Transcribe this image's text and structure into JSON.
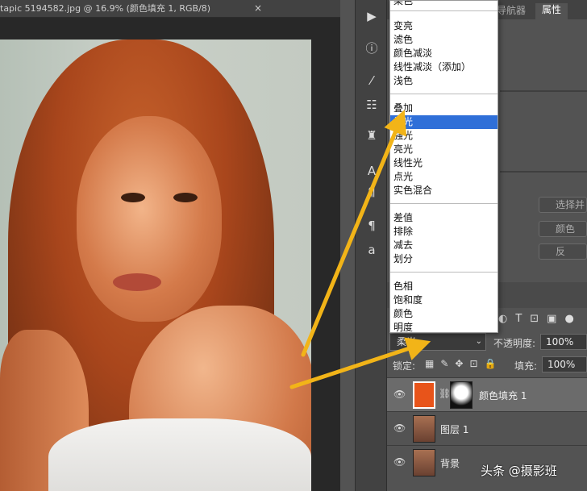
{
  "document": {
    "tab_title": "tapic 5194582.jpg @ 16.9% (颜色填充 1, RGB/8)",
    "close_glyph": "×"
  },
  "panels": {
    "tab_navigator": "导航器",
    "tab_properties": "属性",
    "select_btn": "选择并",
    "color_btn": "颜色",
    "invert_btn": "反"
  },
  "blend_menu": {
    "top_cut": "染色",
    "groups": [
      [
        "变亮",
        "滤色",
        "颜色减淡",
        "线性减淡（添加）",
        "浅色"
      ],
      [
        "叠加",
        "柔光",
        "强光",
        "亮光",
        "线性光",
        "点光",
        "实色混合"
      ],
      [
        "差值",
        "排除",
        "减去",
        "划分"
      ],
      [
        "色相",
        "饱和度",
        "颜色",
        "明度"
      ]
    ],
    "selected": "柔光"
  },
  "layers_panel": {
    "blend_mode_value": "柔光",
    "opacity_label": "不透明度:",
    "opacity_value": "100%",
    "lock_label": "锁定:",
    "fill_label": "填充:",
    "fill_value": "100%",
    "layers": [
      {
        "name": "颜色填充 1",
        "selected": true
      },
      {
        "name": "图层 1",
        "selected": false
      },
      {
        "name": "背景",
        "selected": false
      }
    ]
  },
  "watermark": "头条 @摄影班",
  "colors": {
    "fill_swatch": "#e8541a",
    "menu_highlight": "#2f6fd8",
    "arrow": "#f2b418"
  },
  "icons": {
    "play": "play-icon",
    "info": "info-icon",
    "brush": "brush-settings-icon",
    "sliders": "adjustment-icon",
    "stamp": "clone-source-icon",
    "text": "character-icon",
    "para": "paragraph-icon",
    "glyph": "glyphs-icon"
  }
}
